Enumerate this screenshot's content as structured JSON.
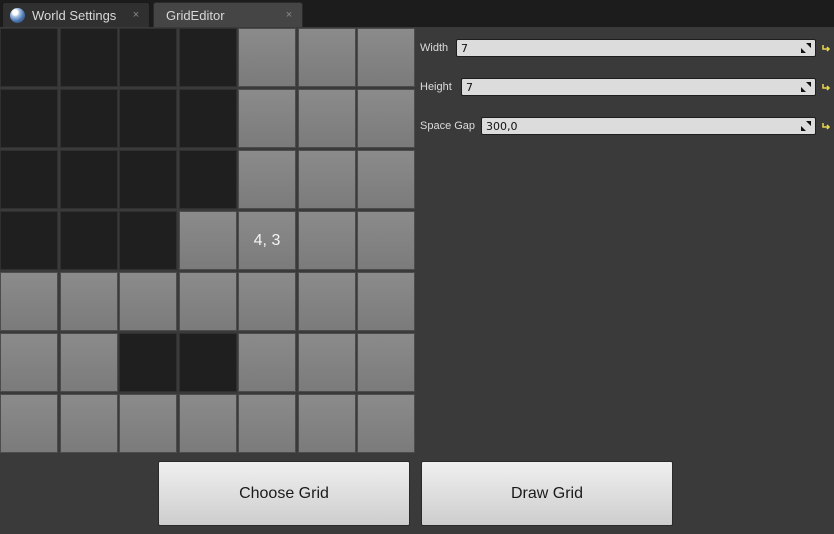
{
  "tabs": [
    {
      "label": "World Settings",
      "icon": "globe-icon",
      "close": "×"
    },
    {
      "label": "GridEditor",
      "close": "×"
    }
  ],
  "grid": {
    "columns": 7,
    "rows": 7,
    "cells": [
      [
        "dark",
        "dark",
        "dark",
        "dark",
        "light",
        "light",
        "light"
      ],
      [
        "dark",
        "dark",
        "dark",
        "dark",
        "light",
        "light",
        "light"
      ],
      [
        "dark",
        "dark",
        "dark",
        "dark",
        "light",
        "light",
        "light"
      ],
      [
        "dark",
        "dark",
        "dark",
        "light",
        "light",
        "light",
        "light"
      ],
      [
        "light",
        "light",
        "light",
        "light",
        "light",
        "light",
        "light"
      ],
      [
        "light",
        "light",
        "dark",
        "dark",
        "light",
        "light",
        "light"
      ],
      [
        "light",
        "light",
        "light",
        "light",
        "light",
        "light",
        "light"
      ]
    ],
    "hover_cell": {
      "row": 3,
      "col": 4,
      "label": "4, 3"
    }
  },
  "properties": {
    "width": {
      "label": "Width",
      "value": "7"
    },
    "height": {
      "label": "Height",
      "value": "7"
    },
    "space_gap": {
      "label": "Space Gap",
      "value": "300,0"
    }
  },
  "buttons": {
    "choose_grid": "Choose Grid",
    "draw_grid": "Draw Grid"
  },
  "colors": {
    "panel_background": "#3a3a3a",
    "cell_dark": "#1f1f1f",
    "cell_light": "#838383",
    "reset_arrow": "#e8d84a"
  }
}
